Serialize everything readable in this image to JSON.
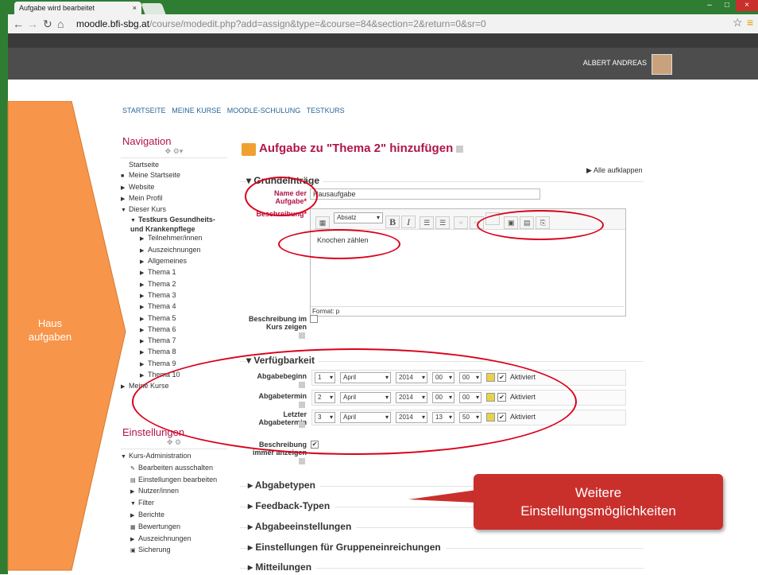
{
  "browser": {
    "tab_title": "Aufgabe wird bearbeitet",
    "tab_close": "×",
    "url_host": "moodle.bfi-sbg.at",
    "url_path": "/course/modedit.php?add=assign&type=&course=84&section=2&return=0&sr=0",
    "window_min": "–",
    "window_max": "□",
    "window_close": "×"
  },
  "topbar": {
    "username": "ALBERT ANDREAS"
  },
  "breadcrumb": [
    "STARTSEITE",
    "MEINE KURSE",
    "MOODLE-SCHULUNG",
    "TESTKURS"
  ],
  "arrow_label": "Haus\naufgaben",
  "navigation": {
    "title": "Navigation",
    "items": [
      {
        "label": "Startseite",
        "indent": 0,
        "marker": ""
      },
      {
        "label": "Meine Startseite",
        "indent": 0,
        "marker": "■"
      },
      {
        "label": "Website",
        "indent": 0,
        "marker": "▶"
      },
      {
        "label": "Mein Profil",
        "indent": 0,
        "marker": "▶"
      },
      {
        "label": "Dieser Kurs",
        "indent": 0,
        "marker": "▼"
      },
      {
        "label": "Testkurs Gesundheits- und Krankenpflege",
        "indent": 1,
        "marker": "▼",
        "bold": true
      },
      {
        "label": "Teilnehmer/innen",
        "indent": 2,
        "marker": "▶"
      },
      {
        "label": "Auszeichnungen",
        "indent": 2,
        "marker": "▶"
      },
      {
        "label": "Allgemeines",
        "indent": 2,
        "marker": "▶"
      },
      {
        "label": "Thema 1",
        "indent": 2,
        "marker": "▶"
      },
      {
        "label": "Thema 2",
        "indent": 2,
        "marker": "▶"
      },
      {
        "label": "Thema 3",
        "indent": 2,
        "marker": "▶"
      },
      {
        "label": "Thema 4",
        "indent": 2,
        "marker": "▶"
      },
      {
        "label": "Thema 5",
        "indent": 2,
        "marker": "▶"
      },
      {
        "label": "Thema 6",
        "indent": 2,
        "marker": "▶"
      },
      {
        "label": "Thema 7",
        "indent": 2,
        "marker": "▶"
      },
      {
        "label": "Thema 8",
        "indent": 2,
        "marker": "▶"
      },
      {
        "label": "Thema 9",
        "indent": 2,
        "marker": "▶"
      },
      {
        "label": "Thema 10",
        "indent": 2,
        "marker": "▶"
      },
      {
        "label": "Meine Kurse",
        "indent": 0,
        "marker": "▶"
      }
    ]
  },
  "settings": {
    "title": "Einstellungen",
    "items": [
      {
        "label": "Kurs-Administration",
        "indent": 0,
        "marker": "▼"
      },
      {
        "label": "Bearbeiten ausschalten",
        "indent": 1,
        "marker": "✎"
      },
      {
        "label": "Einstellungen bearbeiten",
        "indent": 1,
        "marker": "▤"
      },
      {
        "label": "Nutzer/innen",
        "indent": 1,
        "marker": "▶"
      },
      {
        "label": "Filter",
        "indent": 1,
        "marker": "▼"
      },
      {
        "label": "Berichte",
        "indent": 1,
        "marker": "▶"
      },
      {
        "label": "Bewertungen",
        "indent": 1,
        "marker": "▦"
      },
      {
        "label": "Auszeichnungen",
        "indent": 1,
        "marker": "▶"
      },
      {
        "label": "Sicherung",
        "indent": 1,
        "marker": "▣"
      }
    ]
  },
  "main": {
    "heading": "Aufgabe zu \"Thema 2\" hinzufügen",
    "expand_all": "Alle aufklappen",
    "section_general": "Grundeinträge",
    "name_label": "Name der Aufgabe",
    "name_value": "Hausaufgabe",
    "desc_label": "Beschreibung",
    "editor_style": "Absatz",
    "editor_text": "Knochen zählen",
    "editor_path": "Format: p",
    "show_desc_label": "Beschreibung im Kurs zeigen",
    "section_avail": "Verfügbarkeit",
    "dates": [
      {
        "label": "Abgabebeginn",
        "day": "1",
        "month": "April",
        "year": "2014",
        "hour": "00",
        "min": "00",
        "enabled": "Aktiviert"
      },
      {
        "label": "Abgabetermin",
        "day": "2",
        "month": "April",
        "year": "2014",
        "hour": "00",
        "min": "00",
        "enabled": "Aktiviert"
      },
      {
        "label": "Letzter Abgabetermin",
        "day": "3",
        "month": "April",
        "year": "2014",
        "hour": "13",
        "min": "50",
        "enabled": "Aktiviert"
      }
    ],
    "always_show_label": "Beschreibung immer anzeigen",
    "collapsed_sections": [
      "Abgabetypen",
      "Feedback-Typen",
      "Abgabeeinstellungen",
      "Einstellungen für Gruppeneinreichungen",
      "Mitteilungen"
    ]
  },
  "callout": "Weitere\nEinstellungsmöglichkeiten",
  "colors": {
    "accent": "#b0154b",
    "annotation": "#d9001a",
    "arrow": "#f7954a",
    "callout": "#c9302c"
  }
}
